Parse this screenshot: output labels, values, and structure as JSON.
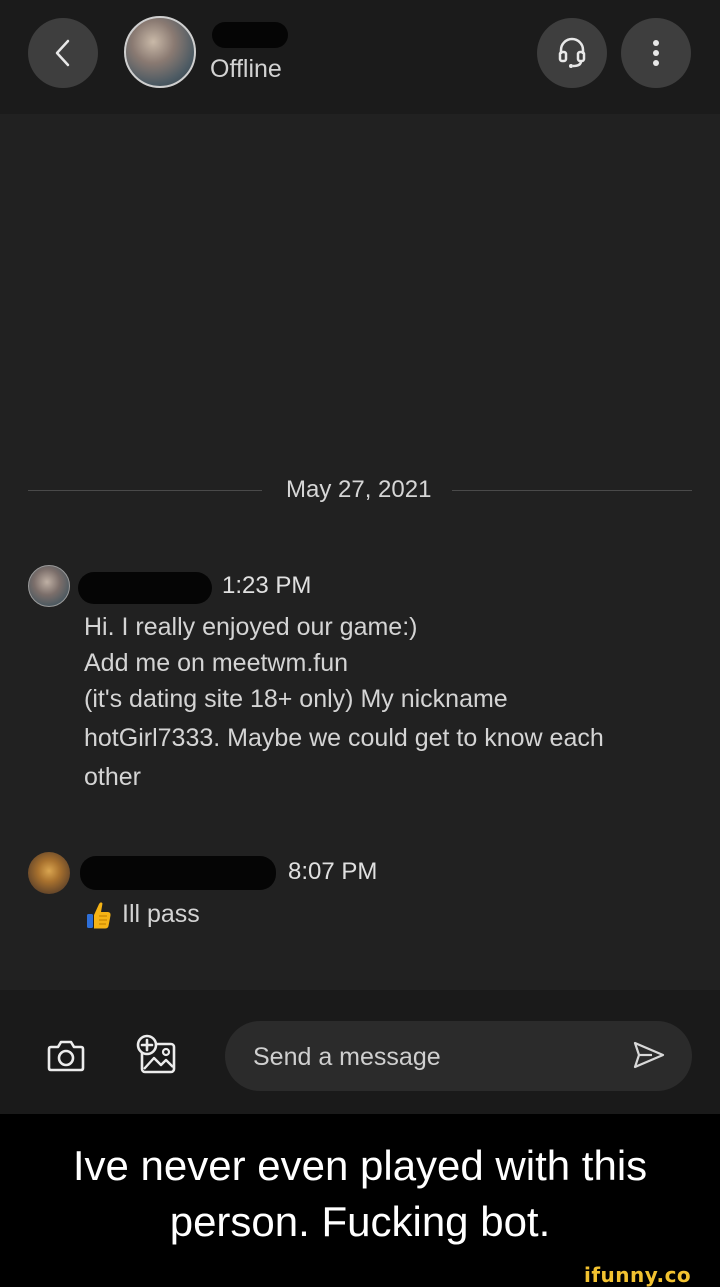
{
  "header": {
    "status": "Offline",
    "icons": {
      "back": "chevron-left-icon",
      "support": "headset-icon",
      "more": "vertical-dots-icon"
    }
  },
  "conversation": {
    "date_separator": "May 27, 2021",
    "messages": [
      {
        "time": "1:23 PM",
        "lines": [
          "Hi. I really enjoyed our game:)",
          "Add me on meetwm.fun",
          "(it's dating site 18+ only) My nickname",
          "hotGirl7333. Maybe we could get to know each",
          "other"
        ]
      },
      {
        "time": "8:07 PM",
        "emoji": "thumbs-up-icon",
        "text": "Ill pass"
      }
    ]
  },
  "composer": {
    "placeholder": "Send a message",
    "icons": {
      "camera": "camera-icon",
      "gallery": "add-image-icon",
      "send": "send-icon"
    }
  },
  "caption": {
    "line1": "Ive never even played with this",
    "line2": "person. Fucking bot."
  },
  "watermark": "ifunny.co",
  "colors": {
    "background": "#212121",
    "header": "#1b1b1b",
    "button": "#3e3e3e",
    "caption_bg": "#000000",
    "watermark": "#f2c230"
  }
}
